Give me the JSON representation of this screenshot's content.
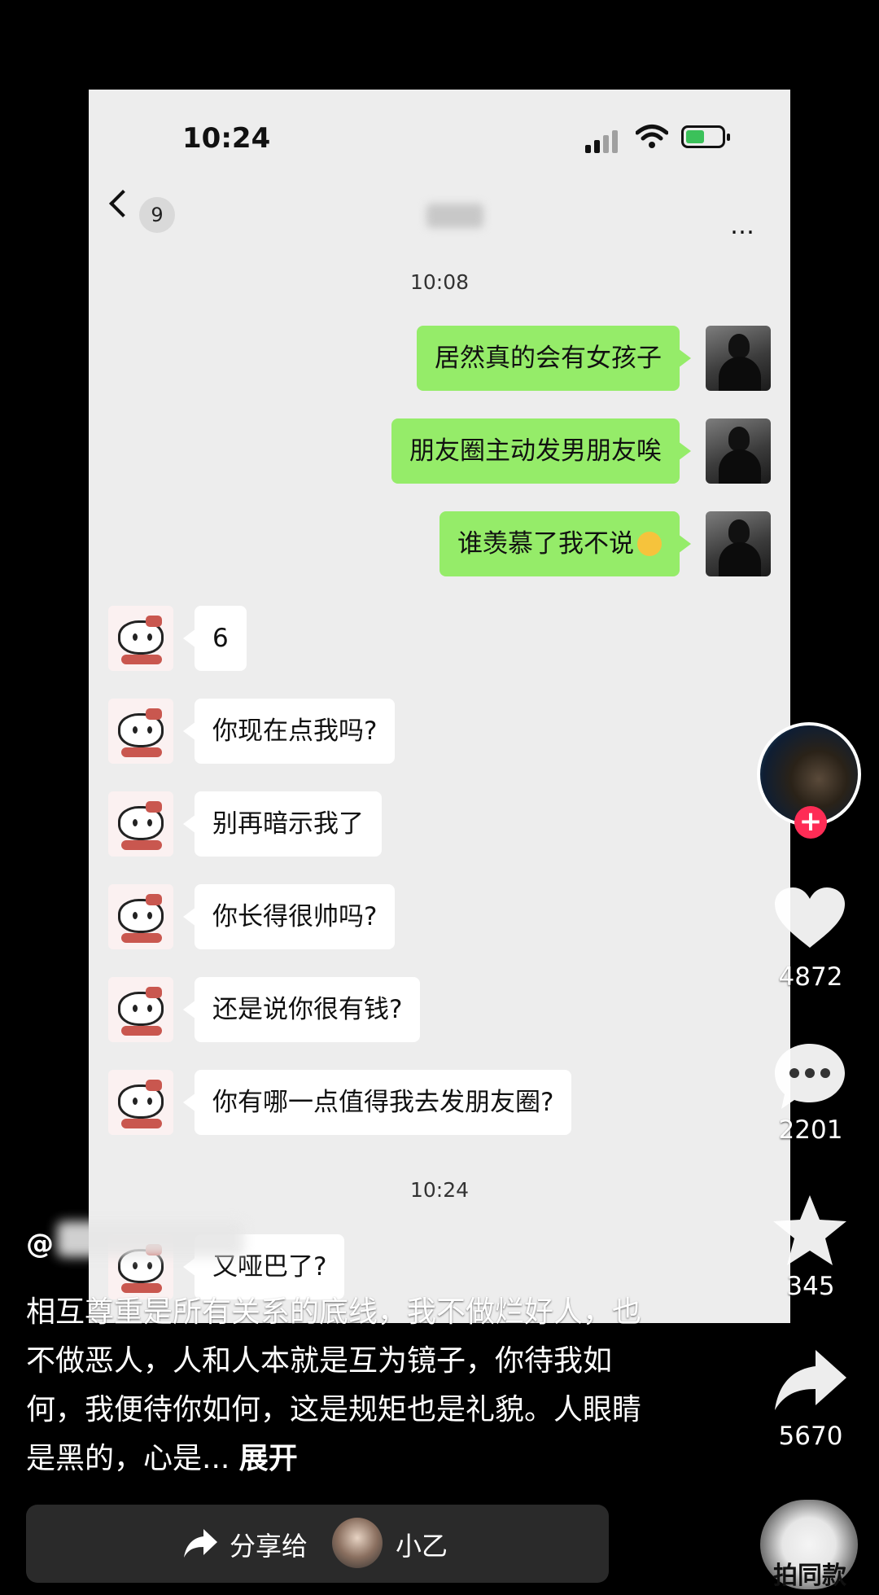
{
  "status_bar": {
    "time": "10:24"
  },
  "chat_header": {
    "unread_badge": "9",
    "more_icon": "…"
  },
  "timestamps": [
    "10:08",
    "10:24"
  ],
  "messages_me": [
    {
      "text": "居然真的会有女孩子"
    },
    {
      "text": "朋友圈主动发男朋友唉"
    },
    {
      "text": "谁羡慕了我不说"
    }
  ],
  "messages_them": [
    {
      "text": "6"
    },
    {
      "text": "你现在点我吗?"
    },
    {
      "text": "别再暗示我了"
    },
    {
      "text": "你长得很帅吗?"
    },
    {
      "text": "还是说你很有钱?"
    },
    {
      "text": "你有哪一点值得我去发朋友圈?"
    },
    {
      "text": "又哑巴了?"
    }
  ],
  "overlay": {
    "username_prefix": "@",
    "caption": "相互尊重是所有关系的底线，我不做烂好人，也不做恶人，人和人本就是互为镜子，你待我如何，我便待你如何，这是规矩也是礼貌。人眼睛是黑的，心是...",
    "expand": "展开",
    "likes": "4872",
    "comments": "2201",
    "favorites": "345",
    "shares": "5670",
    "share_to_label": "分享给",
    "friend_name": "小乙",
    "same_style_label": "拍同款"
  },
  "colors": {
    "my_bubble": "#95ec69",
    "their_bubble": "#ffffff",
    "chat_bg": "#ededed",
    "follow": "#fe2c55"
  }
}
